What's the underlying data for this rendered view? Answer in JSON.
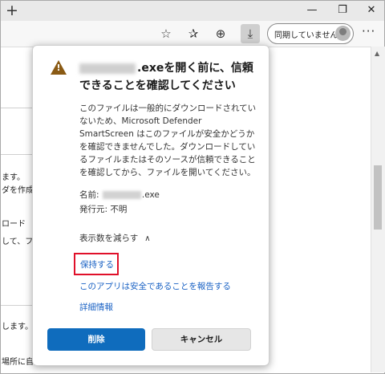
{
  "window": {
    "new_tab_glyph": "+",
    "minimize_glyph": "—",
    "restore_glyph": "❐",
    "close_glyph": "✕"
  },
  "toolbar": {
    "sync_label": "同期していません",
    "icons": [
      "star-add-icon",
      "favorites-icon",
      "collections-icon",
      "download-warning-icon",
      "profile-avatar",
      "more-menu-icon"
    ]
  },
  "background": {
    "lines": [
      "ます。",
      "ダを作成",
      "ロード",
      "して、フ",
      "します。",
      "場所に自"
    ]
  },
  "dialog": {
    "title_suffix": ".exeを開く前に、信頼できることを確認してください",
    "description": "このファイルは一般的にダウンロードされていないため、Microsoft Defender SmartScreen はこのファイルが安全かどうかを確認できませんでした。ダウンロードしているファイルまたはそのソースが信頼できることを確認してから、ファイルを開いてください。",
    "name_label": "名前:",
    "name_suffix": ".exe",
    "publisher_label": "発行元:",
    "publisher_value": "不明",
    "show_less_label": "表示数を減らす",
    "keep_label": "保持する",
    "report_label": "このアプリは安全であることを報告する",
    "details_label": "詳細情報",
    "delete_label": "削除",
    "cancel_label": "キャンセル"
  },
  "colors": {
    "accent": "#0f6cbd",
    "link": "#1a62c4",
    "highlight": "#e0102a",
    "warning": "#8a5a14"
  }
}
